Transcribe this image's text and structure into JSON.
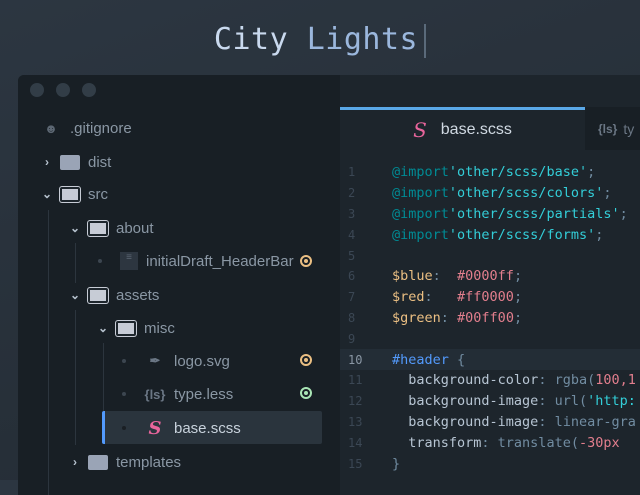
{
  "title": {
    "part1": "City",
    "part2": "Lights"
  },
  "sidebar": {
    "gitignore": ".gitignore",
    "items": [
      {
        "label": "dist"
      },
      {
        "label": "src"
      },
      {
        "label": "about"
      },
      {
        "label": "initialDraft_HeaderBar"
      },
      {
        "label": "assets"
      },
      {
        "label": "misc"
      },
      {
        "label": "logo.svg"
      },
      {
        "label": "type.less"
      },
      {
        "label": "base.scss"
      },
      {
        "label": "templates"
      }
    ],
    "less_icon": "{ls}"
  },
  "colors": {
    "modified": "#ebbf83",
    "added": "#8bd49c",
    "accent": "#539afc",
    "scss": "#e8659c"
  },
  "tabs": [
    {
      "label": "base.scss",
      "icon": "sass-icon"
    },
    {
      "label": "ty",
      "icon": "{ls}"
    }
  ],
  "code": {
    "nums": [
      "1",
      "2",
      "3",
      "4",
      "5",
      "6",
      "7",
      "8",
      "9",
      "10",
      "11",
      "12",
      "13",
      "14",
      "15"
    ],
    "l1": [
      "@import",
      "'other/scss/base'",
      ";"
    ],
    "l2": [
      "@import",
      "'other/scss/colors'",
      ";"
    ],
    "l3": [
      "@import",
      "'other/scss/partials'",
      ";"
    ],
    "l4": [
      "@import",
      "'other/scss/forms'",
      ";"
    ],
    "l6": [
      "$blue",
      ":  ",
      "#0000ff",
      ";"
    ],
    "l7": [
      "$red",
      ":   ",
      "#ff0000",
      ";"
    ],
    "l8": [
      "$green",
      ": ",
      "#00ff00",
      ";"
    ],
    "l10": [
      "#header",
      " {"
    ],
    "l11": [
      "  background-color",
      ": rgba(",
      "100,1"
    ],
    "l12": [
      "  background-image",
      ": url(",
      "'http:"
    ],
    "l13": [
      "  background-image",
      ": linear-gra"
    ],
    "l14": [
      "  transform",
      ": ",
      "translate(",
      "-30px"
    ],
    "l15": [
      "}"
    ]
  }
}
